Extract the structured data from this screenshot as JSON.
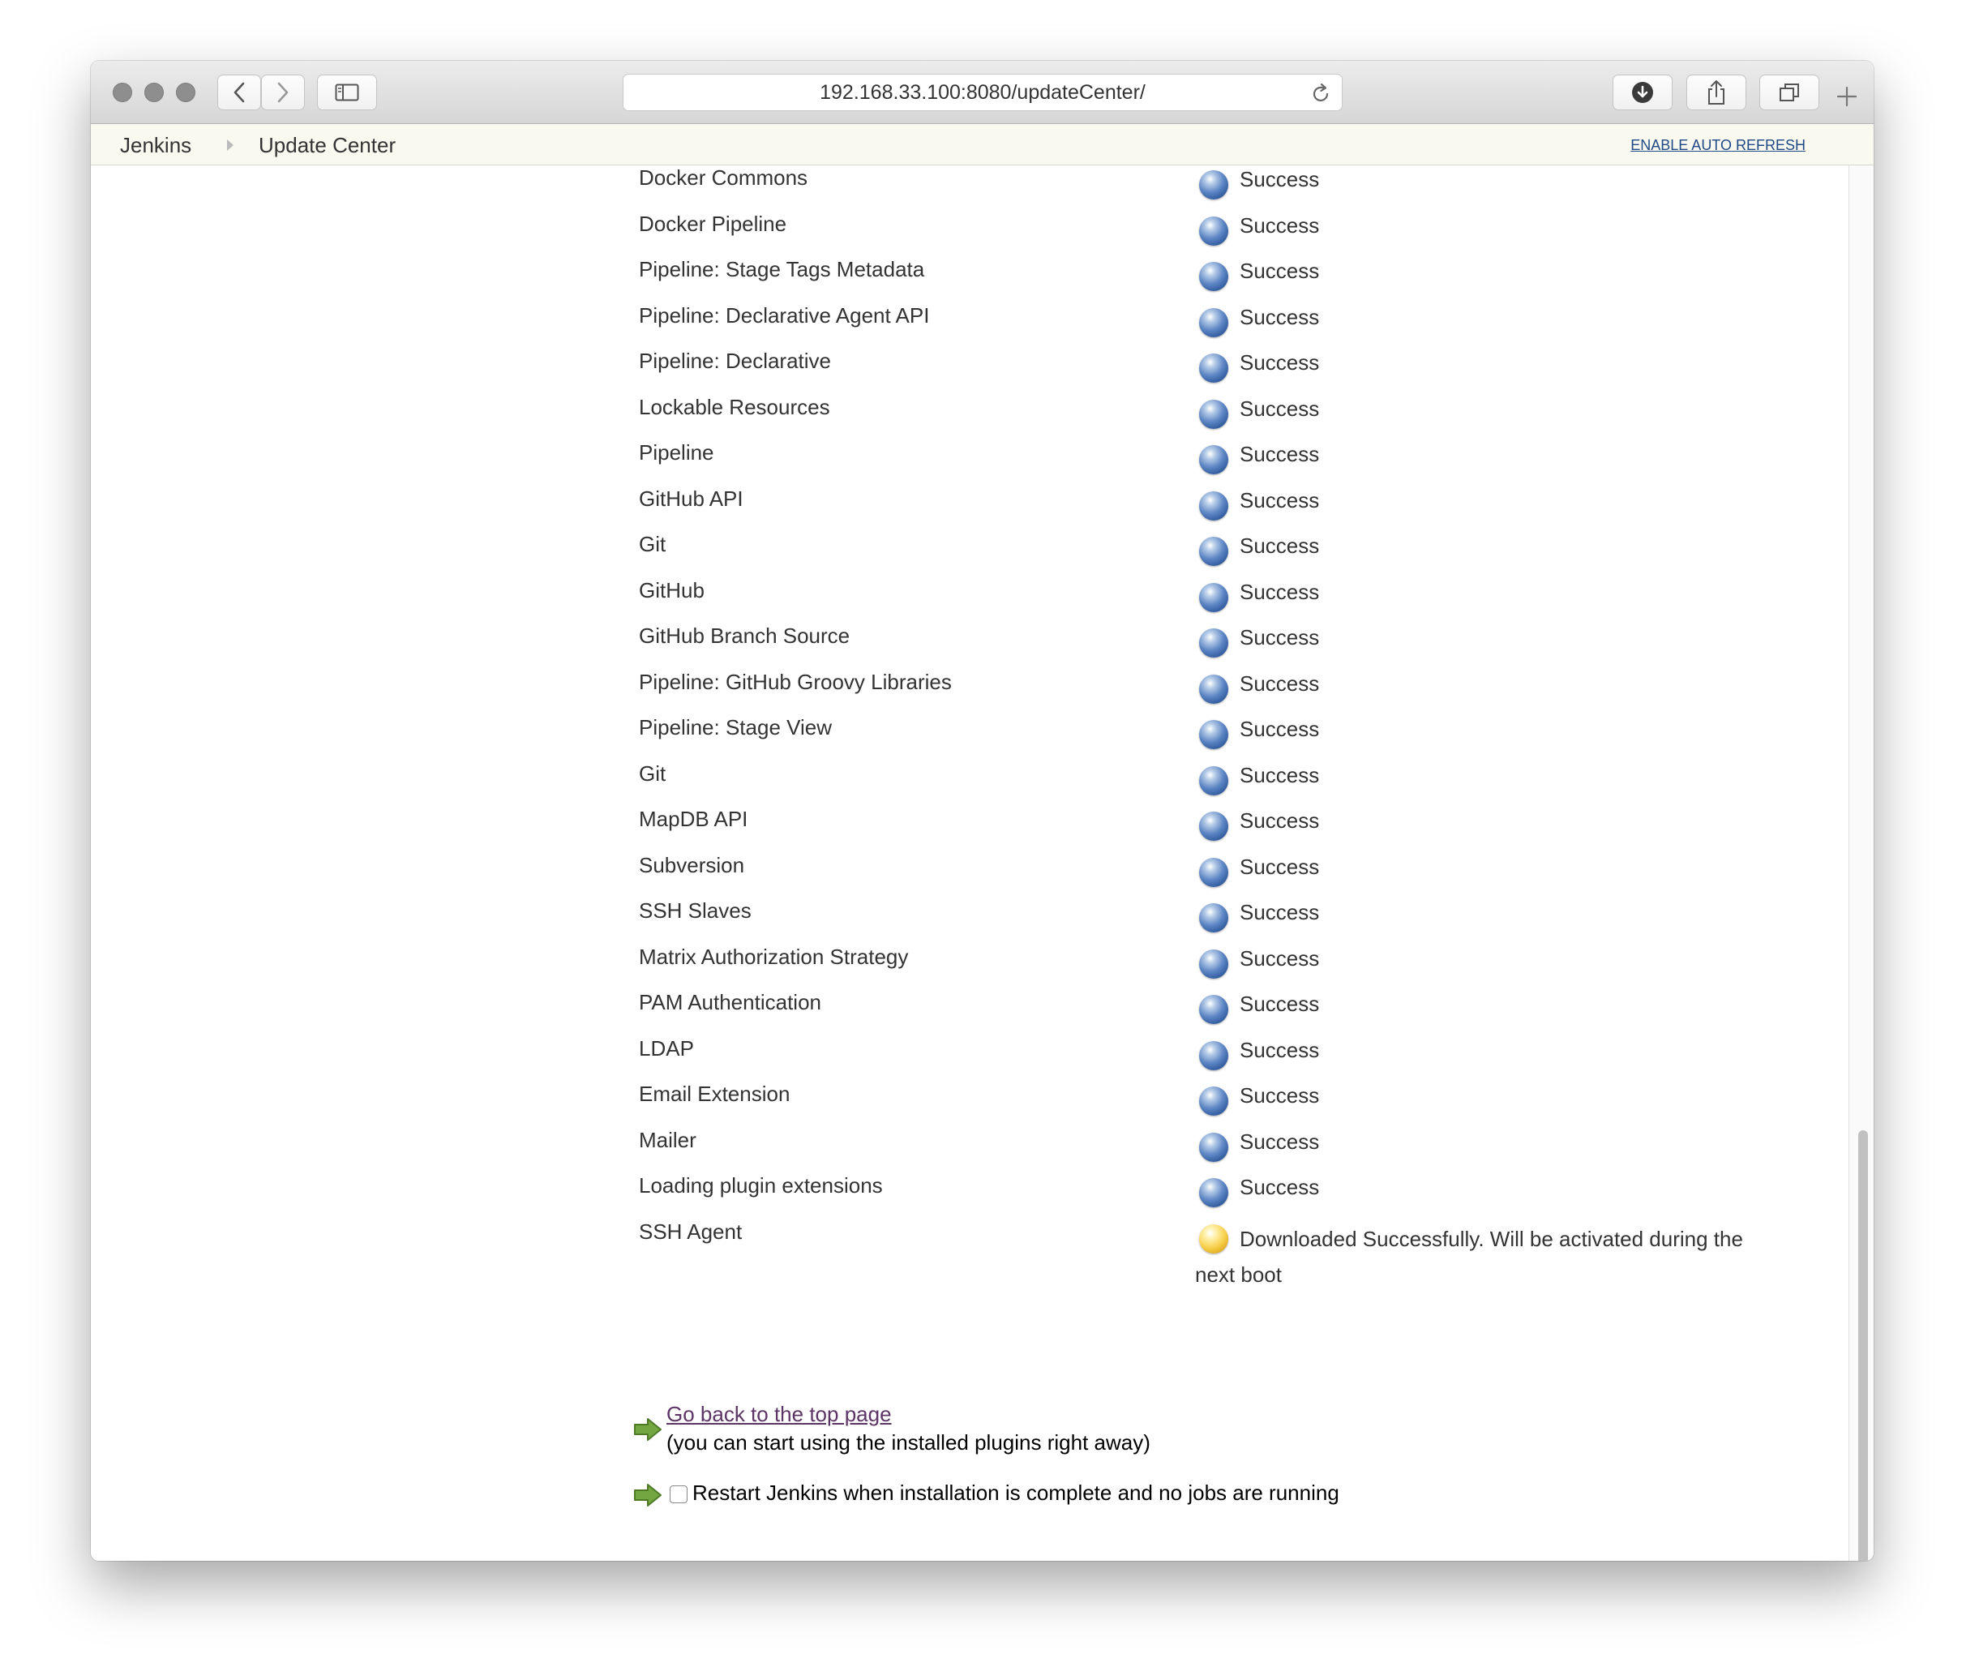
{
  "browser": {
    "url": "192.168.33.100:8080/updateCenter/"
  },
  "breadcrumb": {
    "root": "Jenkins",
    "current": "Update Center",
    "auto_refresh": "ENABLE AUTO REFRESH"
  },
  "plugins": [
    {
      "name": "Docker Commons",
      "status": "Success"
    },
    {
      "name": "Docker Pipeline",
      "status": "Success"
    },
    {
      "name": "Pipeline: Stage Tags Metadata",
      "status": "Success"
    },
    {
      "name": "Pipeline: Declarative Agent API",
      "status": "Success"
    },
    {
      "name": "Pipeline: Declarative",
      "status": "Success"
    },
    {
      "name": "Lockable Resources",
      "status": "Success"
    },
    {
      "name": "Pipeline",
      "status": "Success"
    },
    {
      "name": "GitHub API",
      "status": "Success"
    },
    {
      "name": "Git",
      "status": "Success"
    },
    {
      "name": "GitHub",
      "status": "Success"
    },
    {
      "name": "GitHub Branch Source",
      "status": "Success"
    },
    {
      "name": "Pipeline: GitHub Groovy Libraries",
      "status": "Success"
    },
    {
      "name": "Pipeline: Stage View",
      "status": "Success"
    },
    {
      "name": "Git",
      "status": "Success"
    },
    {
      "name": "MapDB API",
      "status": "Success"
    },
    {
      "name": "Subversion",
      "status": "Success"
    },
    {
      "name": "SSH Slaves",
      "status": "Success"
    },
    {
      "name": "Matrix Authorization Strategy",
      "status": "Success"
    },
    {
      "name": "PAM Authentication",
      "status": "Success"
    },
    {
      "name": "LDAP",
      "status": "Success"
    },
    {
      "name": "Email Extension",
      "status": "Success"
    },
    {
      "name": "Mailer",
      "status": "Success"
    },
    {
      "name": "Loading plugin extensions",
      "status": "Success"
    },
    {
      "name": "SSH Agent",
      "status": "Downloaded Successfully. Will be activated during the next boot"
    }
  ],
  "status_colors": {
    "success": "#4a72b5",
    "pending": "#f2c230"
  },
  "actions": {
    "go_back_link": "Go back to the top page",
    "go_back_note": "(you can start using the installed plugins right away)",
    "restart_label": "Restart Jenkins when installation is complete and no jobs are running",
    "restart_checked": false
  }
}
